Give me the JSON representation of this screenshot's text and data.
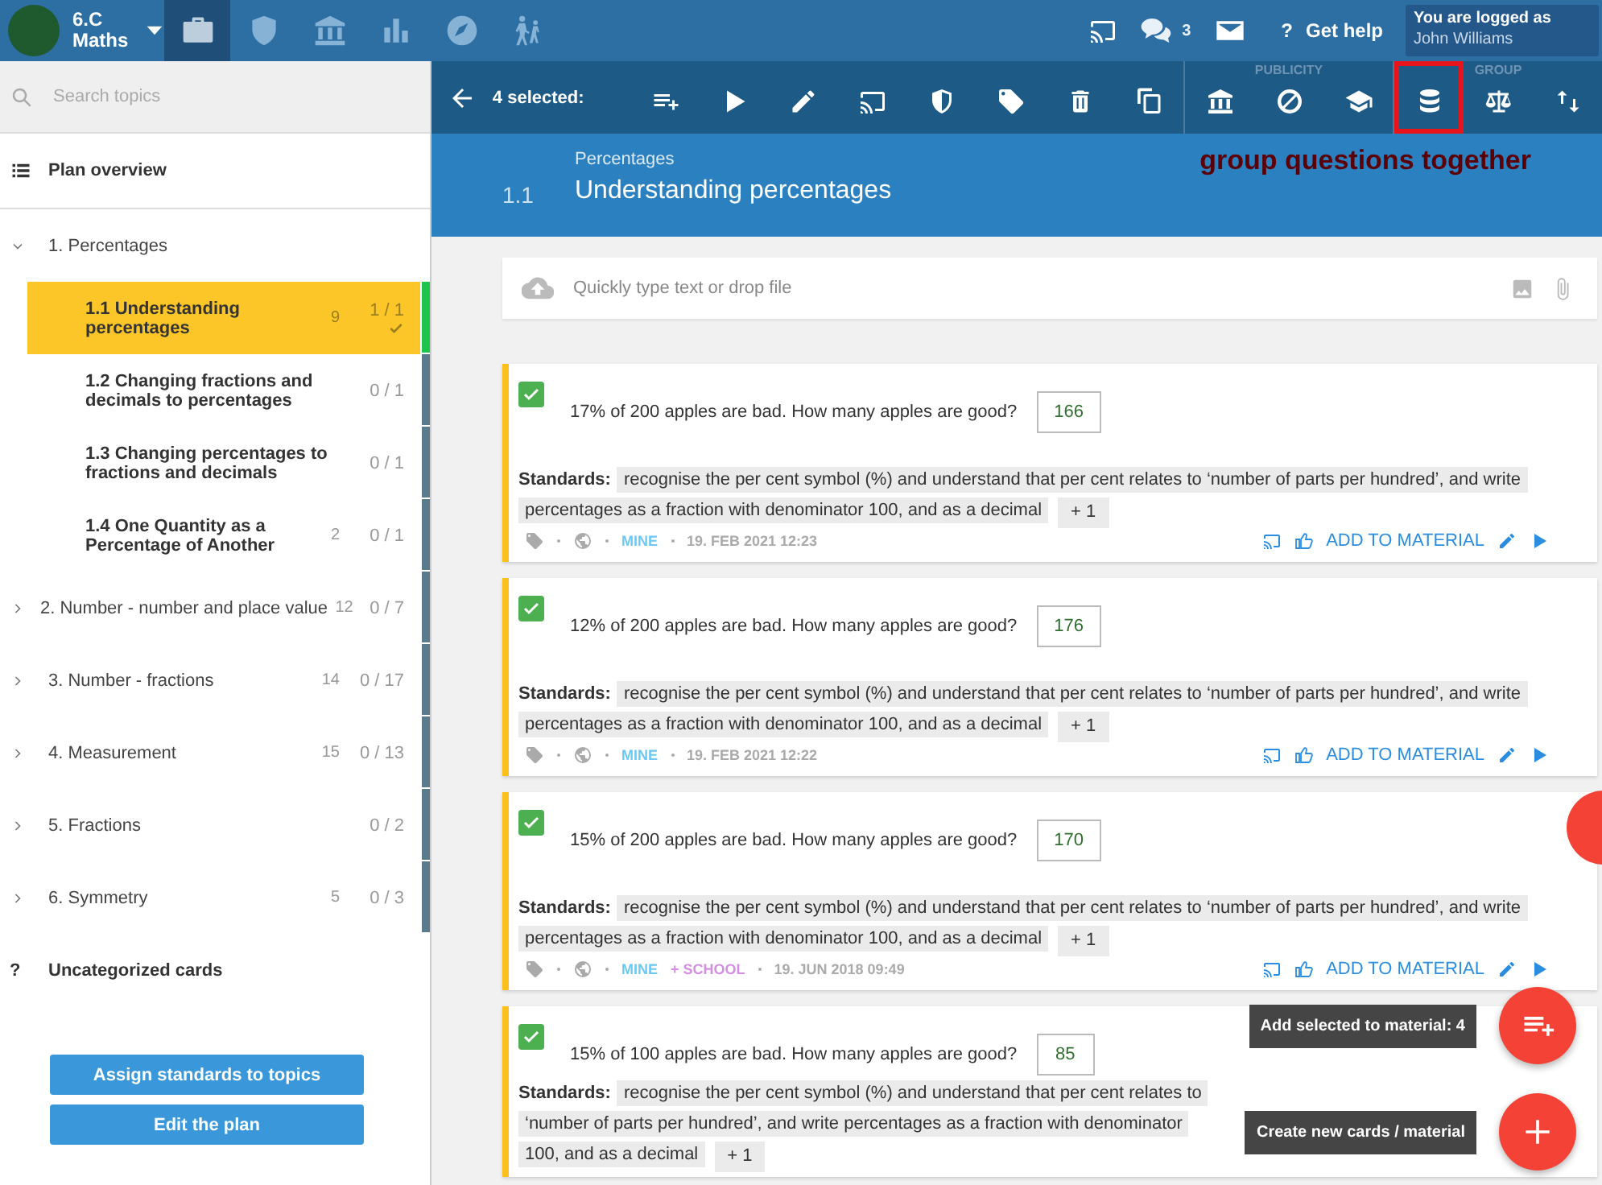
{
  "topbar": {
    "class_name": "6.C",
    "subject": "Maths",
    "nav": [
      {
        "kind": "briefcase",
        "selected": true
      },
      {
        "kind": "shield",
        "selected": false
      },
      {
        "kind": "bank",
        "selected": false
      },
      {
        "kind": "bars",
        "selected": false
      },
      {
        "kind": "compass",
        "selected": false
      },
      {
        "kind": "hikers",
        "selected": false
      }
    ],
    "chat_count": "3",
    "help_mark": "?",
    "help": "Get help",
    "login_label": "You are logged as",
    "user": "John Williams"
  },
  "sidebar": {
    "search": {
      "placeholder": "Search topics"
    },
    "plan_overview": "Plan overview",
    "topics": [
      {
        "label": "1. Percentages",
        "expanded": true,
        "children": [
          {
            "label": "1.1 Understanding percentages",
            "count": "9",
            "progress": "1 / 1",
            "done": true,
            "selected": true
          },
          {
            "label": "1.2 Changing fractions and decimals to percentages",
            "progress": "0 / 1",
            "done": false,
            "selected": false
          },
          {
            "label": "1.3 Changing percentages to fractions and decimals",
            "progress": "0 / 1",
            "done": false,
            "selected": false
          },
          {
            "label": "1.4 One Quantity as a Percentage of Another",
            "count": "2",
            "progress": "0 / 1",
            "done": false,
            "selected": false
          }
        ]
      },
      {
        "label": "2. Number - number and place value",
        "count": "12",
        "progress": "0 / 7",
        "expanded": false,
        "done": false
      },
      {
        "label": "3. Number - fractions",
        "count": "14",
        "progress": "0 / 17",
        "expanded": false,
        "done": false
      },
      {
        "label": "4. Measurement",
        "count": "15",
        "progress": "0 / 13",
        "expanded": false,
        "done": false
      },
      {
        "label": "5. Fractions",
        "progress": "0 / 2",
        "expanded": false,
        "done": false
      },
      {
        "label": "6. Symmetry",
        "count": "5",
        "progress": "0 / 3",
        "expanded": false,
        "done": false
      }
    ],
    "uncategorized_mark": "?",
    "uncategorized": "Uncategorized cards",
    "buttons": [
      "Assign standards to topics",
      "Edit the plan"
    ]
  },
  "toolbar": {
    "selected_label": "4 selected:",
    "groups": [
      {
        "actions": [
          {
            "kind": "list-add",
            "highlighted": false
          },
          {
            "kind": "play",
            "highlighted": false
          },
          {
            "kind": "pencil",
            "highlighted": false
          },
          {
            "kind": "cast",
            "highlighted": false
          },
          {
            "kind": "shield-half",
            "highlighted": false
          },
          {
            "kind": "tag",
            "highlighted": false
          },
          {
            "kind": "trash",
            "highlighted": false
          },
          {
            "kind": "copy",
            "highlighted": false
          }
        ]
      },
      {
        "label": "PUBLICITY",
        "actions": [
          {
            "kind": "bank",
            "highlighted": false
          },
          {
            "kind": "block",
            "highlighted": false
          },
          {
            "kind": "cap",
            "highlighted": false
          }
        ]
      },
      {
        "label": "GROUP",
        "actions": [
          {
            "kind": "database",
            "highlighted": true
          },
          {
            "kind": "scale",
            "highlighted": false
          },
          {
            "kind": "sort",
            "highlighted": false
          }
        ]
      }
    ]
  },
  "annotation": "group questions together",
  "header": {
    "breadcrumb": "Percentages",
    "number": "1.1",
    "title": "Understanding percentages"
  },
  "composer": {
    "placeholder": "Quickly type text or drop file"
  },
  "cards": [
    {
      "checked": true,
      "question": "17% of 200 apples are bad. How many apples are good?",
      "answer": "166",
      "standards_label": "Standards:",
      "standard": "recognise the per cent symbol (%) and understand that per cent relates to ‘number of parts per hundred’, and write percentages as a fraction with denominator 100, and as a decimal",
      "more": "+ 1",
      "footer": {
        "owners": [
          {
            "text": "MINE",
            "color": "#6ec8f4"
          }
        ],
        "date": "19. FEB 2021 12:23",
        "add": "ADD TO MATERIAL"
      }
    },
    {
      "checked": true,
      "question": "12% of 200 apples are bad. How many apples are good?",
      "answer": "176",
      "standards_label": "Standards:",
      "standard": "recognise the per cent symbol (%) and understand that per cent relates to ‘number of parts per hundred’, and write percentages as a fraction with denominator 100, and as a decimal",
      "more": "+ 1",
      "footer": {
        "owners": [
          {
            "text": "MINE",
            "color": "#6ec8f4"
          }
        ],
        "date": "19. FEB 2021 12:22",
        "add": "ADD TO MATERIAL"
      }
    },
    {
      "checked": true,
      "question": "15% of 200 apples are bad. How many apples are good?",
      "answer": "170",
      "standards_label": "Standards:",
      "standard": "recognise the per cent symbol (%) and understand that per cent relates to ‘number of parts per hundred’, and write percentages as a fraction with denominator 100, and as a decimal",
      "more": "+ 1",
      "footer": {
        "owners": [
          {
            "text": "MINE",
            "color": "#6ec8f4"
          },
          {
            "text": "+ SCHOOL",
            "color": "#d28fe0"
          }
        ],
        "date": "19. JUN 2018 09:49",
        "add": "ADD TO MATERIAL"
      }
    },
    {
      "checked": true,
      "question": "15% of 100 apples are bad. How many apples are good?",
      "answer": "85",
      "standards_label": "Standards:",
      "standard": "recognise the per cent symbol (%) and understand that per cent relates to ‘number of parts per hundred’, and write percentages as a fraction with denominator 100, and as a decimal",
      "more": "+ 1"
    }
  ],
  "fabs": [
    {
      "kind": "list-add",
      "tooltip": "Add selected to material: 4"
    },
    {
      "kind": "plus",
      "tooltip": "Create new cards / material"
    }
  ]
}
